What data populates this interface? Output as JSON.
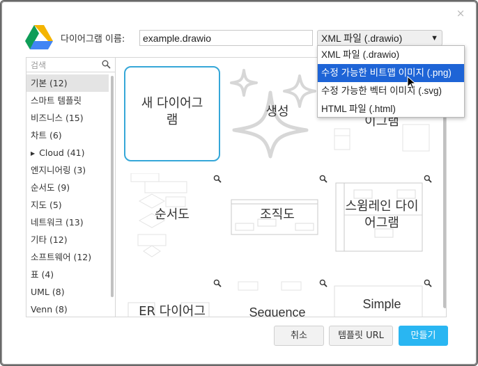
{
  "dialog": {
    "name_label": "다이어그램 이름:",
    "filename_value": "example.drawio",
    "close_glyph": "×"
  },
  "format": {
    "selected": "XML 파일 (.drawio)",
    "options": [
      "XML 파일 (.drawio)",
      "수정 가능한 비트맵 이미지 (.png)",
      "수정 가능한 벡터 이미지 (.svg)",
      "HTML 파일 (.html)"
    ],
    "highlighted_index": 1
  },
  "sidebar": {
    "search_placeholder": "검색",
    "categories": [
      {
        "label": "기본 (12)",
        "active": true
      },
      {
        "label": "스마트 템플릿"
      },
      {
        "label": "비즈니스 (15)"
      },
      {
        "label": "차트 (6)"
      },
      {
        "label": "Cloud (41)",
        "expandable": true
      },
      {
        "label": "엔지니어링 (3)"
      },
      {
        "label": "순서도 (9)"
      },
      {
        "label": "지도 (5)"
      },
      {
        "label": "네트워크 (13)"
      },
      {
        "label": "기타 (12)"
      },
      {
        "label": "소프트웨어 (12)"
      },
      {
        "label": "표 (4)"
      },
      {
        "label": "UML (8)"
      },
      {
        "label": "Venn (8)"
      }
    ]
  },
  "templates": {
    "new_diagram": "새 다이어그램",
    "generate": "생성",
    "partial_diagram": "이그램",
    "flowchart": "순서도",
    "orgchart": "조직도",
    "swimlane": "스윔레인 다이어그램",
    "er": "ER 다이어그",
    "sequence": "Sequence",
    "simple": "Simple"
  },
  "buttons": {
    "cancel": "취소",
    "template_url": "템플릿 URL",
    "create": "만들기"
  },
  "colors": {
    "accent": "#29b6f2",
    "selection_border": "#35a7d8",
    "highlight": "#1e64d6"
  }
}
